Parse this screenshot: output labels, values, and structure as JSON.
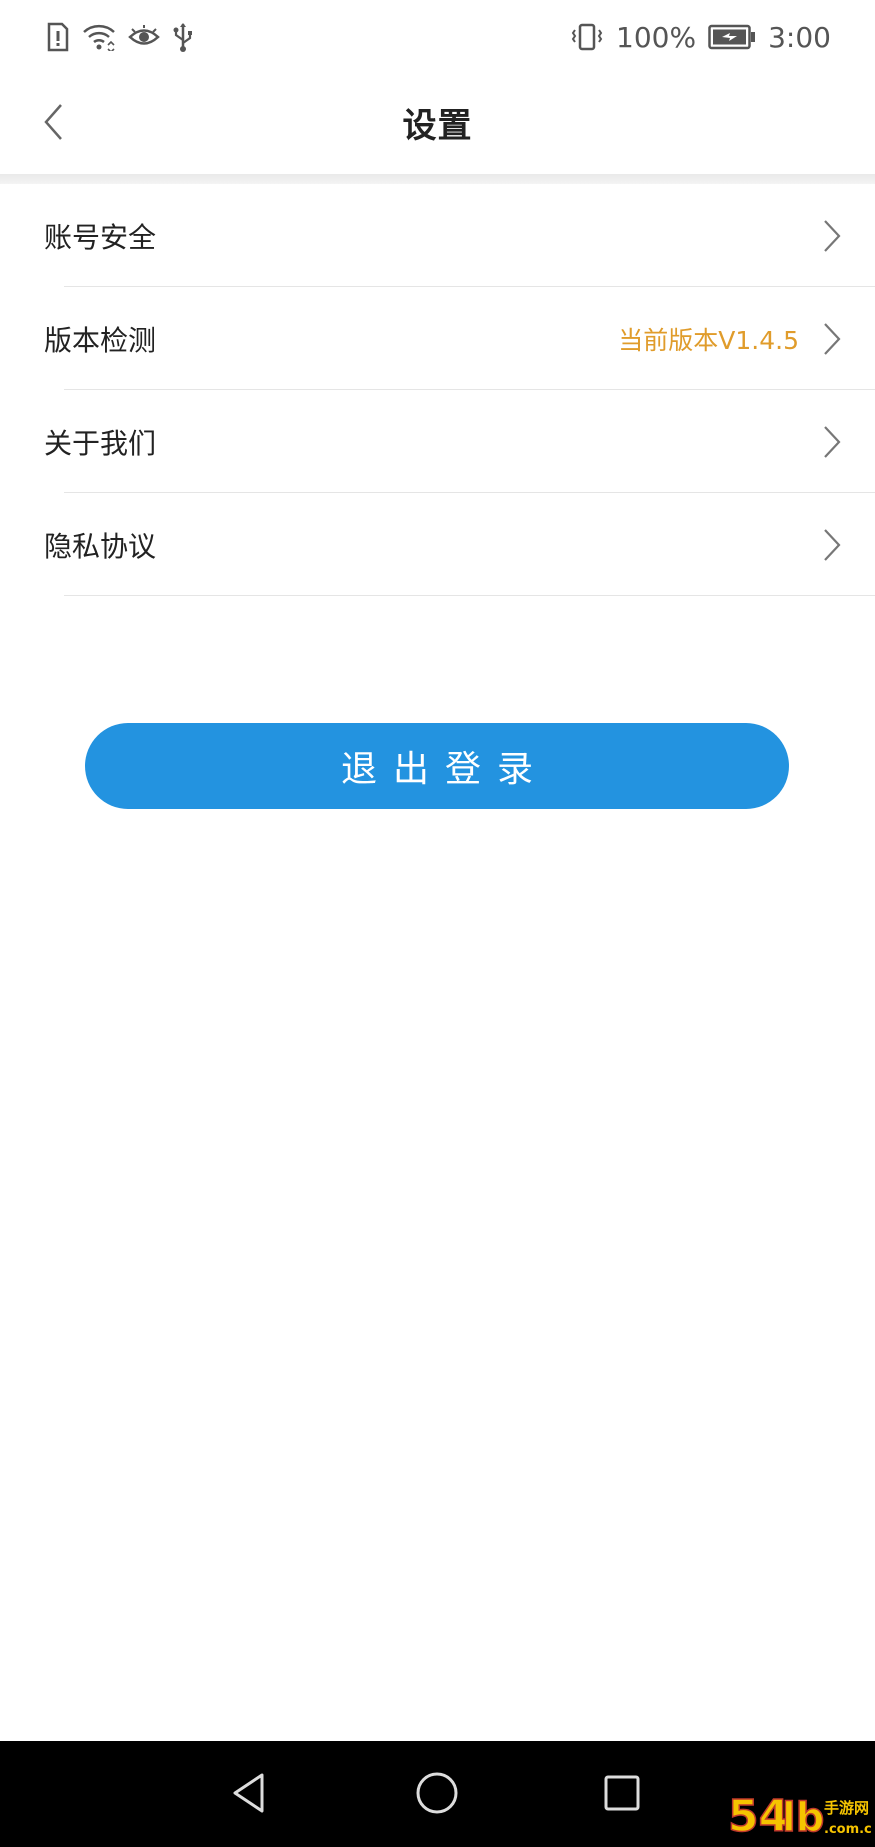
{
  "status_bar": {
    "battery_percent": "100%",
    "time": "3:00",
    "left_icons": [
      "sim-alert-icon",
      "wifi-icon",
      "eye-icon",
      "usb-icon"
    ],
    "right_icons": [
      "vibrate-icon",
      "battery-charging-icon"
    ]
  },
  "header": {
    "title": "设置",
    "back_icon": "chevron-left-icon"
  },
  "settings": {
    "items": [
      {
        "label": "账号安全",
        "value": ""
      },
      {
        "label": "版本检测",
        "value": "当前版本V1.4.5"
      },
      {
        "label": "关于我们",
        "value": ""
      },
      {
        "label": "隐私协议",
        "value": ""
      }
    ]
  },
  "logout": {
    "label": "退出登录"
  },
  "nav_bar": {
    "icons": [
      "back-triangle-icon",
      "home-circle-icon",
      "recents-square-icon"
    ]
  },
  "colors": {
    "accent_blue": "#2393e0",
    "version_orange": "#e09c2b",
    "nav_bg": "#000000"
  }
}
